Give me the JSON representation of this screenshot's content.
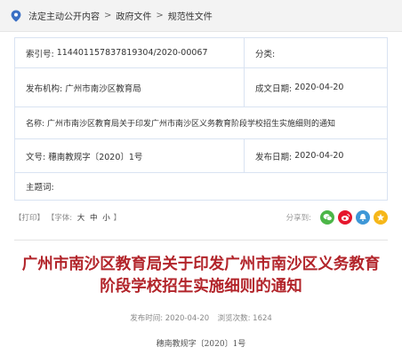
{
  "breadcrumb": {
    "items": [
      "法定主动公开内容",
      "政府文件",
      "规范性文件"
    ],
    "separator": ">"
  },
  "meta": {
    "index_label": "索引号:",
    "index_value": "114401157837819304/2020-00067",
    "category_label": "分类:",
    "category_value": "",
    "publisher_label": "发布机构:",
    "publisher_value": "广州市南沙区教育局",
    "created_label": "成文日期:",
    "created_value": "2020-04-20",
    "name_label": "名称:",
    "name_value": "广州市南沙区教育局关于印发广州市南沙区义务教育阶段学校招生实施细则的通知",
    "docno_label": "文号:",
    "docno_value": "穗南教规字〔2020〕1号",
    "published_label": "发布日期:",
    "published_value": "2020-04-20",
    "subject_label": "主题词:",
    "subject_value": ""
  },
  "tools": {
    "print": "【打印】",
    "font_prefix": "【字体:",
    "font_large": "大",
    "font_medium": "中",
    "font_small": "小",
    "font_suffix": "】",
    "share_label": "分享到:",
    "share_colors": {
      "wechat": "#4cb648",
      "weibo": "#e6162d",
      "qzone": "#3e97d7",
      "favorite": "#f6b719"
    }
  },
  "article": {
    "title": "广州市南沙区教育局关于印发广州市南沙区义务教育阶段学校招生实施细则的通知",
    "publish_time_label": "发布时间:",
    "publish_time_value": "2020-04-20",
    "views_label": "浏览次数:",
    "views_value": "1624",
    "doc_number": "穗南教规字〔2020〕1号"
  },
  "colors": {
    "title_red": "#b2242a",
    "border_blue": "#d9e3f2",
    "pin_blue": "#3a6fc4"
  }
}
